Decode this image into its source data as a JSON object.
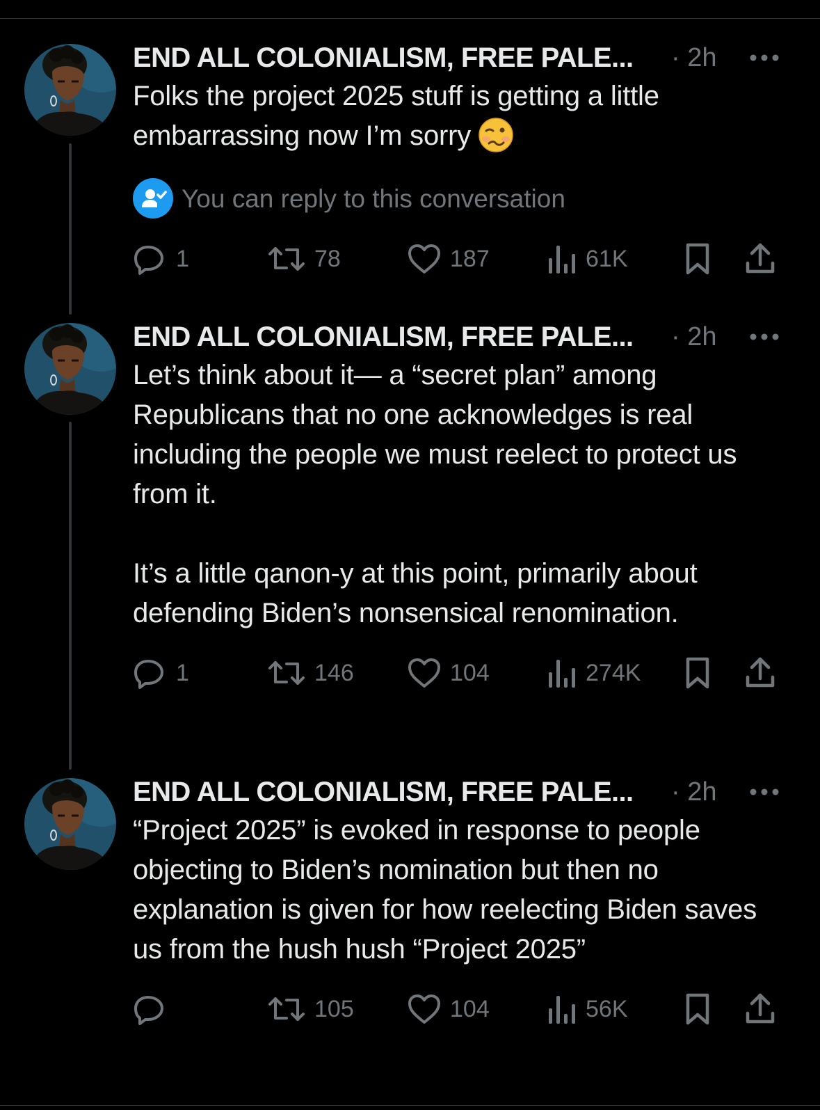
{
  "theme": {
    "background": "#000000",
    "text_primary": "#e7e9ea",
    "text_secondary": "#71767b",
    "accent": "#1d9bf0",
    "thread_line": "#333639",
    "emoji_face": "#f7c23a"
  },
  "tweets": [
    {
      "author_name": "END ALL COLONIALISM, FREE PALE...",
      "meta": "· 2h",
      "paragraphs": [
        "Folks the project 2025 stuff is getting a little embarrassing now I’m sorry"
      ],
      "emoji": "woozy-face-emoji",
      "reply_notice": "You can reply to this conversation",
      "stats": {
        "replies": "1",
        "reposts": "78",
        "likes": "187",
        "views": "61K"
      }
    },
    {
      "author_name": "END ALL COLONIALISM, FREE PALE...",
      "meta": "· 2h",
      "paragraphs": [
        "Let’s think about it— a “secret plan” among Republicans that no one acknowledges is real including the people we must reelect to protect us from it.",
        "It’s a little qanon-y at this point, primarily about defending Biden’s nonsensical renomination."
      ],
      "stats": {
        "replies": "1",
        "reposts": "146",
        "likes": "104",
        "views": "274K"
      }
    },
    {
      "author_name": "END ALL COLONIALISM, FREE PALE...",
      "meta": "· 2h",
      "paragraphs": [
        "“Project 2025” is evoked in response to people objecting to Biden’s nomination but then no explanation is given for how reelecting Biden saves us from the hush hush “Project 2025”"
      ],
      "stats": {
        "replies": "",
        "reposts": "105",
        "likes": "104",
        "views": "56K"
      }
    }
  ]
}
